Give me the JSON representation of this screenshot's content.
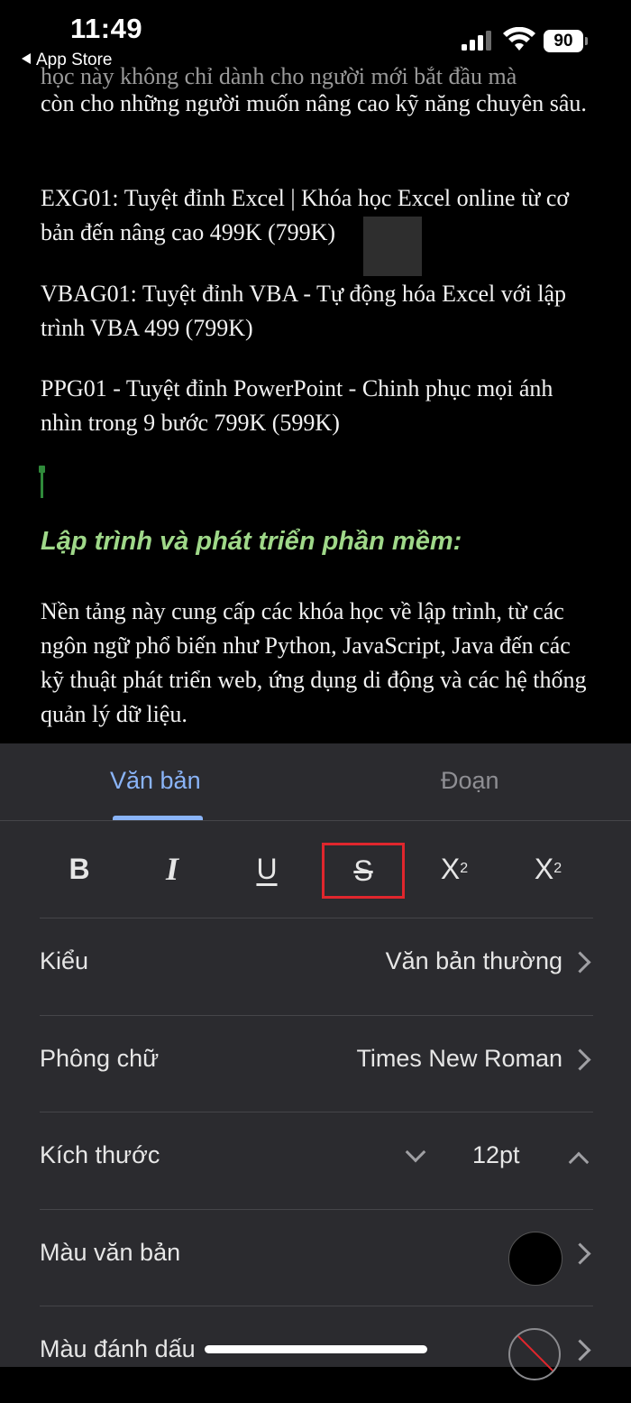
{
  "status_bar": {
    "time": "11:49",
    "back_label": "App Store",
    "battery": "90"
  },
  "document": {
    "partial_line": "học này không chỉ dành cho người mới bắt đầu mà",
    "paragraphs": [
      "còn cho những người muốn nâng cao kỹ năng chuyên sâu.",
      "EXG01: Tuyệt đỉnh Excel | Khóa học Excel online từ cơ bản đến nâng cao 499K (799K)",
      "VBAG01: Tuyệt đỉnh VBA - Tự động hóa Excel với lập trình VBA 499 (799K)",
      "PPG01 - Tuyệt đỉnh PowerPoint - Chinh phục mọi ánh nhìn trong 9 bước 799K (599K)"
    ],
    "heading": "Lập trình và phát triển phần mềm:",
    "body": "Nền tảng này cung cấp các khóa học về lập trình, từ các ngôn ngữ phổ biến như Python, JavaScript, Java đến các kỹ thuật phát triển web, ứng dụng di động và các hệ thống quản lý dữ liệu."
  },
  "panel": {
    "tabs": [
      {
        "label": "Văn bản",
        "active": true
      },
      {
        "label": "Đoạn",
        "active": false
      }
    ],
    "format_buttons": {
      "bold": "B",
      "italic": "I",
      "underline": "U",
      "strikethrough": "S",
      "superscript_base": "X",
      "superscript_mark": "2",
      "subscript_base": "X",
      "subscript_mark": "2"
    },
    "rows": {
      "style": {
        "label": "Kiểu",
        "value": "Văn bản thường"
      },
      "font": {
        "label": "Phông chữ",
        "value": "Times New Roman"
      },
      "size": {
        "label": "Kích thước",
        "value": "12pt"
      },
      "text_color": {
        "label": "Màu văn bản",
        "color": "#000000"
      },
      "highlight_color": {
        "label": "Màu đánh dấu",
        "color": "none"
      }
    }
  },
  "colors": {
    "accent": "#8ab4f8",
    "heading": "#9fd889",
    "highlight_box": "#e0262d",
    "panel_bg": "#2b2b2f"
  }
}
